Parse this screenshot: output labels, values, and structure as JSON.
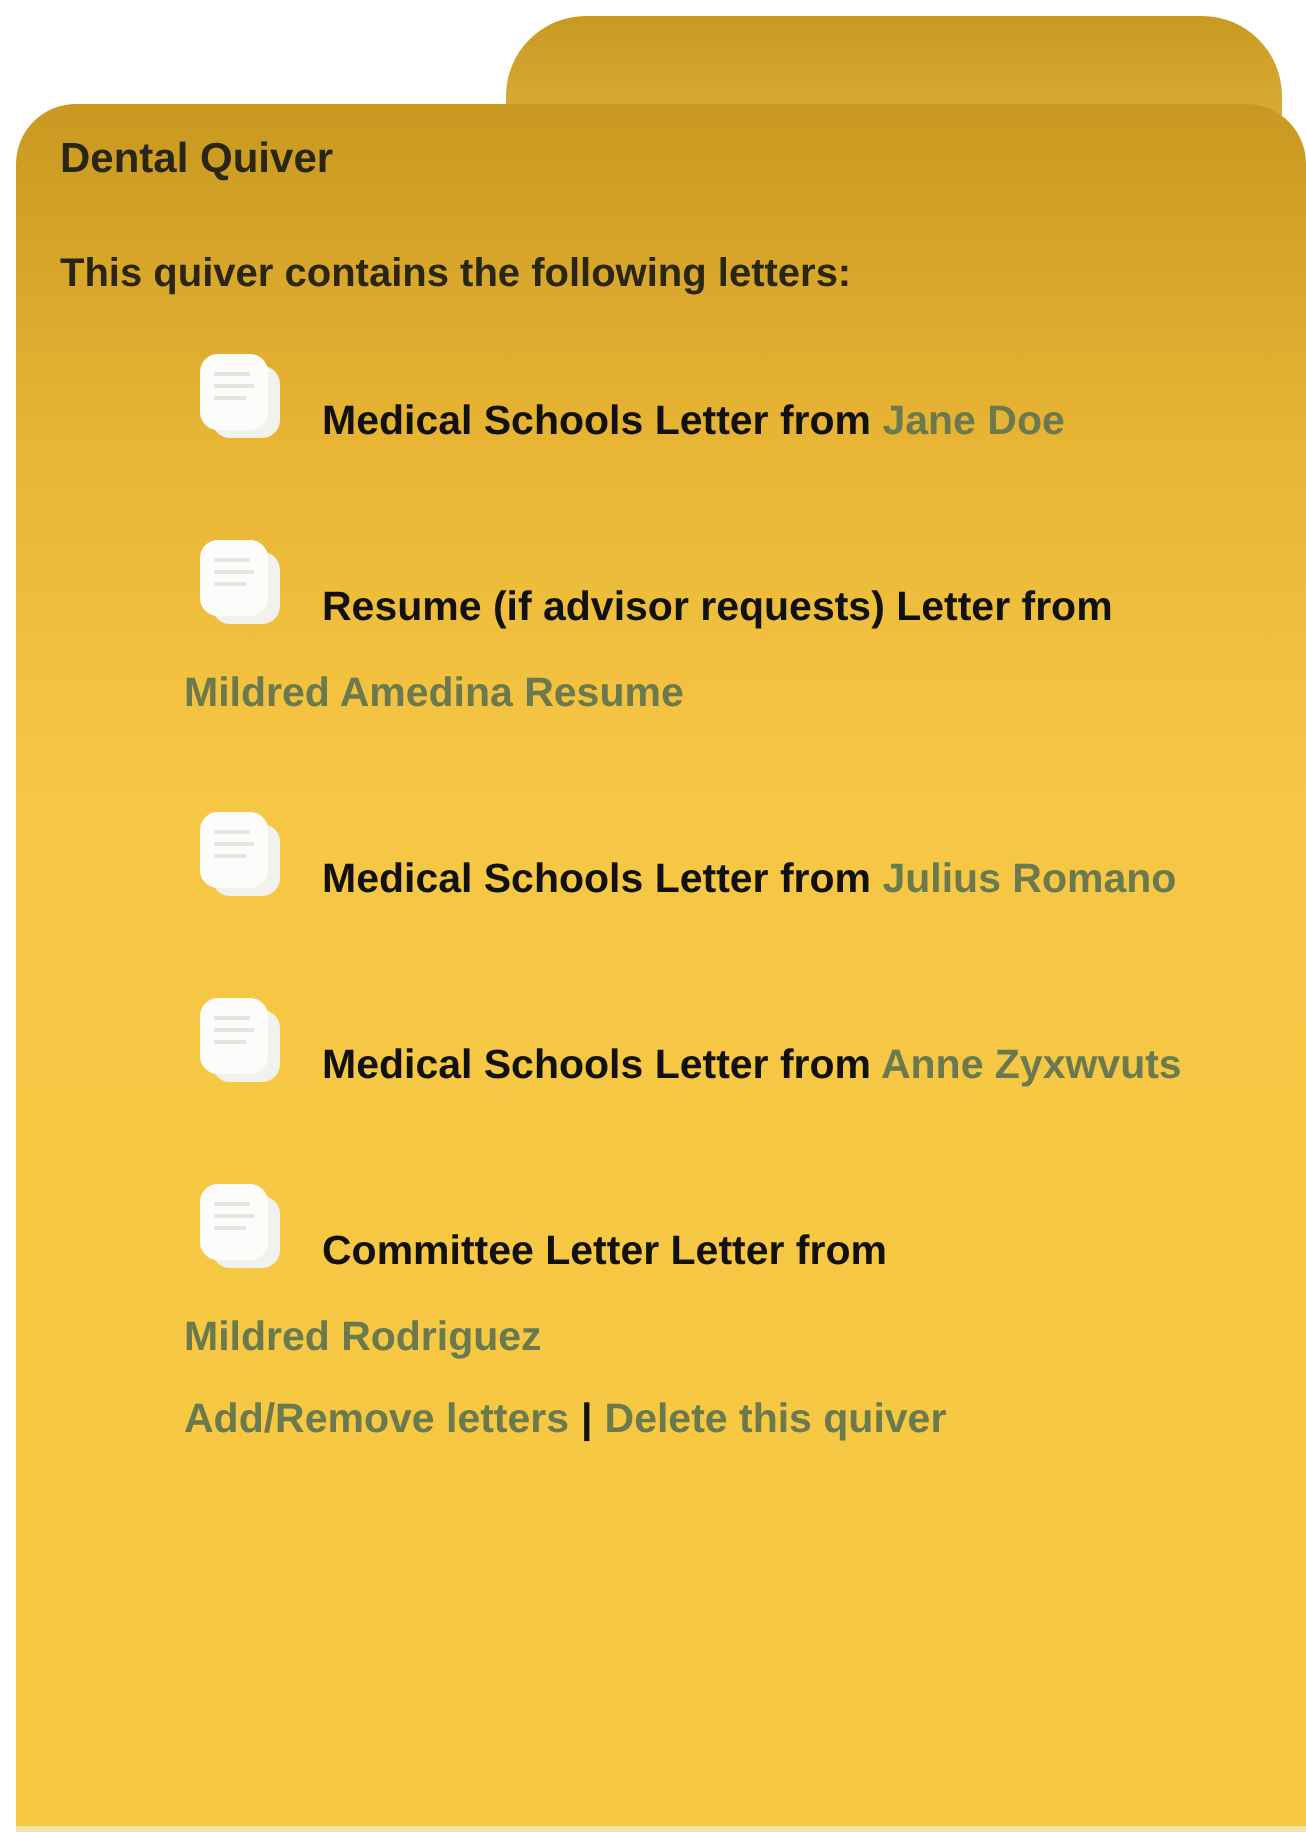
{
  "quiver": {
    "title": "Dental Quiver",
    "intro": "This quiver contains the following letters:",
    "letters": [
      {
        "text": "Medical Schools Letter from",
        "author": "Jane Doe"
      },
      {
        "text": "Resume (if advisor requests) Letter from",
        "author": "Mildred Amedina Resume"
      },
      {
        "text": "Medical Schools Letter from",
        "author": "Julius Romano"
      },
      {
        "text": "Medical Schools Letter from",
        "author": "Anne Zyxwvuts"
      },
      {
        "text": "Committee Letter Letter from",
        "author": "Mildred Rodriguez"
      }
    ],
    "actions": [
      "Add/Remove letters",
      "Delete this quiver"
    ],
    "separator": "|"
  }
}
